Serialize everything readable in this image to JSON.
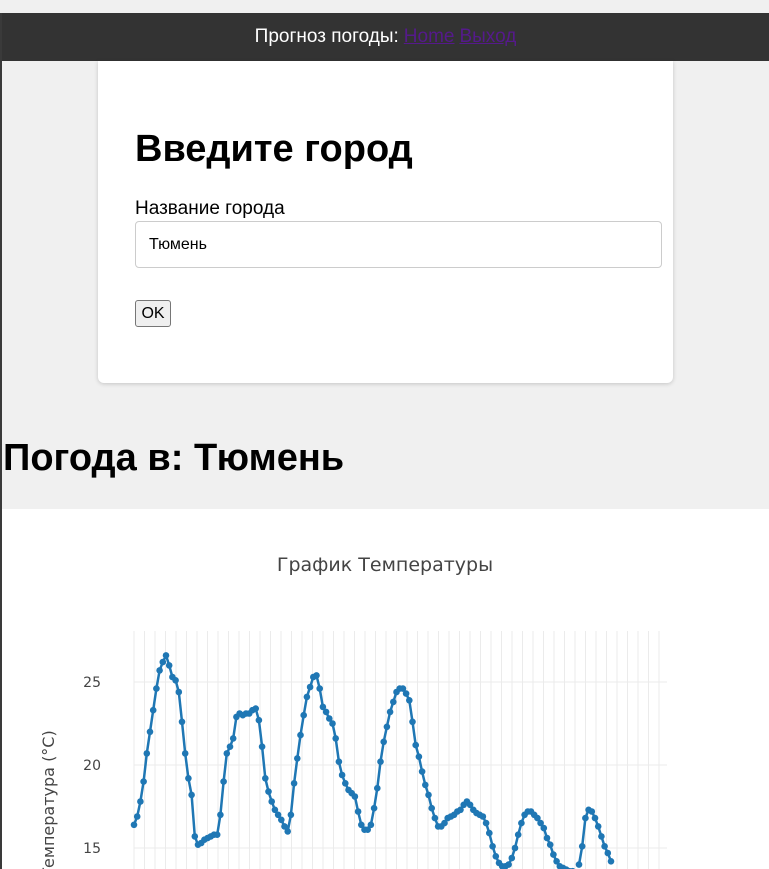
{
  "navbar": {
    "title": "Прогноз погоды:",
    "links": [
      {
        "label": "Home"
      },
      {
        "label": "Выход"
      }
    ]
  },
  "form": {
    "heading": "Введите город",
    "city_label": "Название города",
    "city_value": "Тюмень",
    "submit_label": "OK"
  },
  "weather": {
    "heading": "Погода в: Тюмень"
  },
  "chart_data": {
    "type": "line",
    "title": "График Температуры",
    "ylabel": "Температура (°C)",
    "xlabel": "",
    "yticks": [
      "15",
      "20",
      "25"
    ],
    "ylim": [
      13.5,
      27.8
    ],
    "line_color": "#1f77b4",
    "grid": true,
    "series": [
      {
        "values": [
          16.4,
          16.9,
          17.8,
          19.0,
          20.7,
          22.0,
          23.3,
          24.6,
          25.7,
          26.2,
          26.6,
          26.0,
          25.3,
          25.1,
          24.4,
          22.6,
          20.7,
          19.2,
          18.2,
          15.7,
          15.2,
          15.3,
          15.5,
          15.6,
          15.7,
          15.8,
          15.8,
          17.0,
          19.0,
          20.7,
          21.1,
          21.6,
          22.9,
          23.1,
          23.0,
          23.1,
          23.1,
          23.3,
          23.4,
          22.7,
          21.1,
          19.2,
          18.4,
          17.8,
          17.3,
          17.0,
          16.7,
          16.3,
          16.0,
          17.0,
          18.9,
          20.4,
          21.8,
          23.0,
          24.1,
          24.7,
          25.3,
          25.4,
          24.6,
          23.5,
          23.2,
          22.8,
          22.5,
          21.6,
          20.2,
          19.4,
          18.9,
          18.5,
          18.3,
          18.1,
          17.2,
          16.4,
          16.1,
          16.1,
          16.4,
          17.4,
          18.6,
          20.2,
          21.4,
          22.3,
          23.2,
          23.8,
          24.4,
          24.6,
          24.6,
          24.3,
          23.9,
          22.6,
          21.2,
          20.5,
          19.6,
          18.8,
          18.2,
          17.4,
          16.8,
          16.3,
          16.3,
          16.5,
          16.8,
          16.9,
          17.0,
          17.2,
          17.3,
          17.6,
          17.8,
          17.6,
          17.3,
          17.1,
          17.0,
          16.9,
          16.5,
          15.9,
          15.1,
          14.5,
          14.1,
          13.9,
          13.9,
          14.0,
          14.4,
          15.0,
          15.8,
          16.5,
          17.0,
          17.2,
          17.2,
          17.0,
          16.8,
          16.5,
          16.2,
          15.6,
          15.2,
          14.6,
          14.2,
          13.9,
          13.8,
          13.7,
          13.6,
          13.6,
          null,
          14.0,
          15.1,
          16.8,
          17.3,
          17.2,
          16.8,
          16.3,
          15.7,
          15.1,
          14.7,
          14.2
        ]
      }
    ]
  }
}
